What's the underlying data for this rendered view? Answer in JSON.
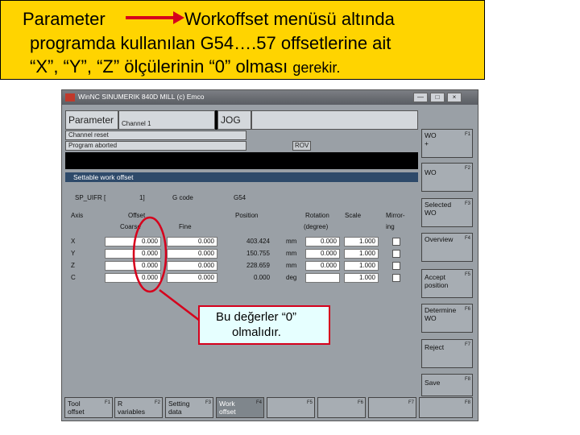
{
  "banner": {
    "line1_left": "Parameter",
    "line1_right": "Workoffset menüsü altında",
    "line2": "programda kullanılan G54….57 offsetlerine ait",
    "line3": "“X”, “Y”, “Z” ölçülerinin “0” olması",
    "line3_tail": "gerekir."
  },
  "window": {
    "title": "WinNC SINUMERIK 840D MILL (c) Emco",
    "buttons": [
      "—",
      "□",
      "×"
    ]
  },
  "header": {
    "area": "Parameter",
    "channel": "Channel 1",
    "mode": "JOG",
    "status1": "Channel reset",
    "status2": "Program aborted",
    "rov": "ROV"
  },
  "panel": {
    "title": "Settable work offset",
    "selector": "SP_UIFR  [",
    "selector_index": "1]",
    "gcode_label": "G code",
    "gcode_value": "G54",
    "columns": {
      "axis": "Axis",
      "offset": "Offset",
      "coarse": "Coarse",
      "fine": "Fine",
      "position": "Position",
      "rotation": "Rotation",
      "rotation_unit": "(degree)",
      "scale": "Scale",
      "mirror": "Mirror-",
      "mirror2": "ing"
    },
    "rows": [
      {
        "axis": "X",
        "coarse": "0.000",
        "fine": "0.000",
        "position": "403.424",
        "unit": "mm",
        "rotation": "0.000",
        "scale": "1.000"
      },
      {
        "axis": "Y",
        "coarse": "0.000",
        "fine": "0.000",
        "position": "150.755",
        "unit": "mm",
        "rotation": "0.000",
        "scale": "1.000"
      },
      {
        "axis": "Z",
        "coarse": "0.000",
        "fine": "0.000",
        "position": "228.659",
        "unit": "mm",
        "rotation": "0.000",
        "scale": "1.000"
      },
      {
        "axis": "C",
        "coarse": "0.000",
        "fine": "0.000",
        "position": "0.000",
        "unit": "deg",
        "rotation": "",
        "scale": "1.000"
      }
    ]
  },
  "right_softkeys": [
    {
      "label": "WO\n+",
      "fn": "F1"
    },
    {
      "label": "WO",
      "fn": "F2"
    },
    {
      "label": "Selected\nWO",
      "fn": "F3"
    },
    {
      "label": "Overview",
      "fn": "F4"
    },
    {
      "label": "Accept\nposition",
      "fn": "F5"
    },
    {
      "label": "Determine\nWO",
      "fn": "F6"
    },
    {
      "label": "Reject",
      "fn": "F7"
    },
    {
      "label": "Save",
      "fn": "F8"
    }
  ],
  "bottom_softkeys": [
    {
      "label": "Tool\noffset",
      "fn": "F1"
    },
    {
      "label": "R\nvariables",
      "fn": "F2"
    },
    {
      "label": "Setting\ndata",
      "fn": "F3"
    },
    {
      "label": "Work\noffset",
      "fn": "F4"
    },
    {
      "label": "",
      "fn": "F5"
    },
    {
      "label": "",
      "fn": "F6"
    },
    {
      "label": "",
      "fn": "F7"
    },
    {
      "label": "",
      "fn": "F8"
    }
  ],
  "callout": {
    "line1": "Bu değerler “0”",
    "line2": "olmalıdır."
  },
  "colors": {
    "banner_bg": "#ffd400",
    "accent_red": "#d6001c",
    "callout_bg": "#e6ffff",
    "panel_title_bg": "#2e4a6a"
  }
}
